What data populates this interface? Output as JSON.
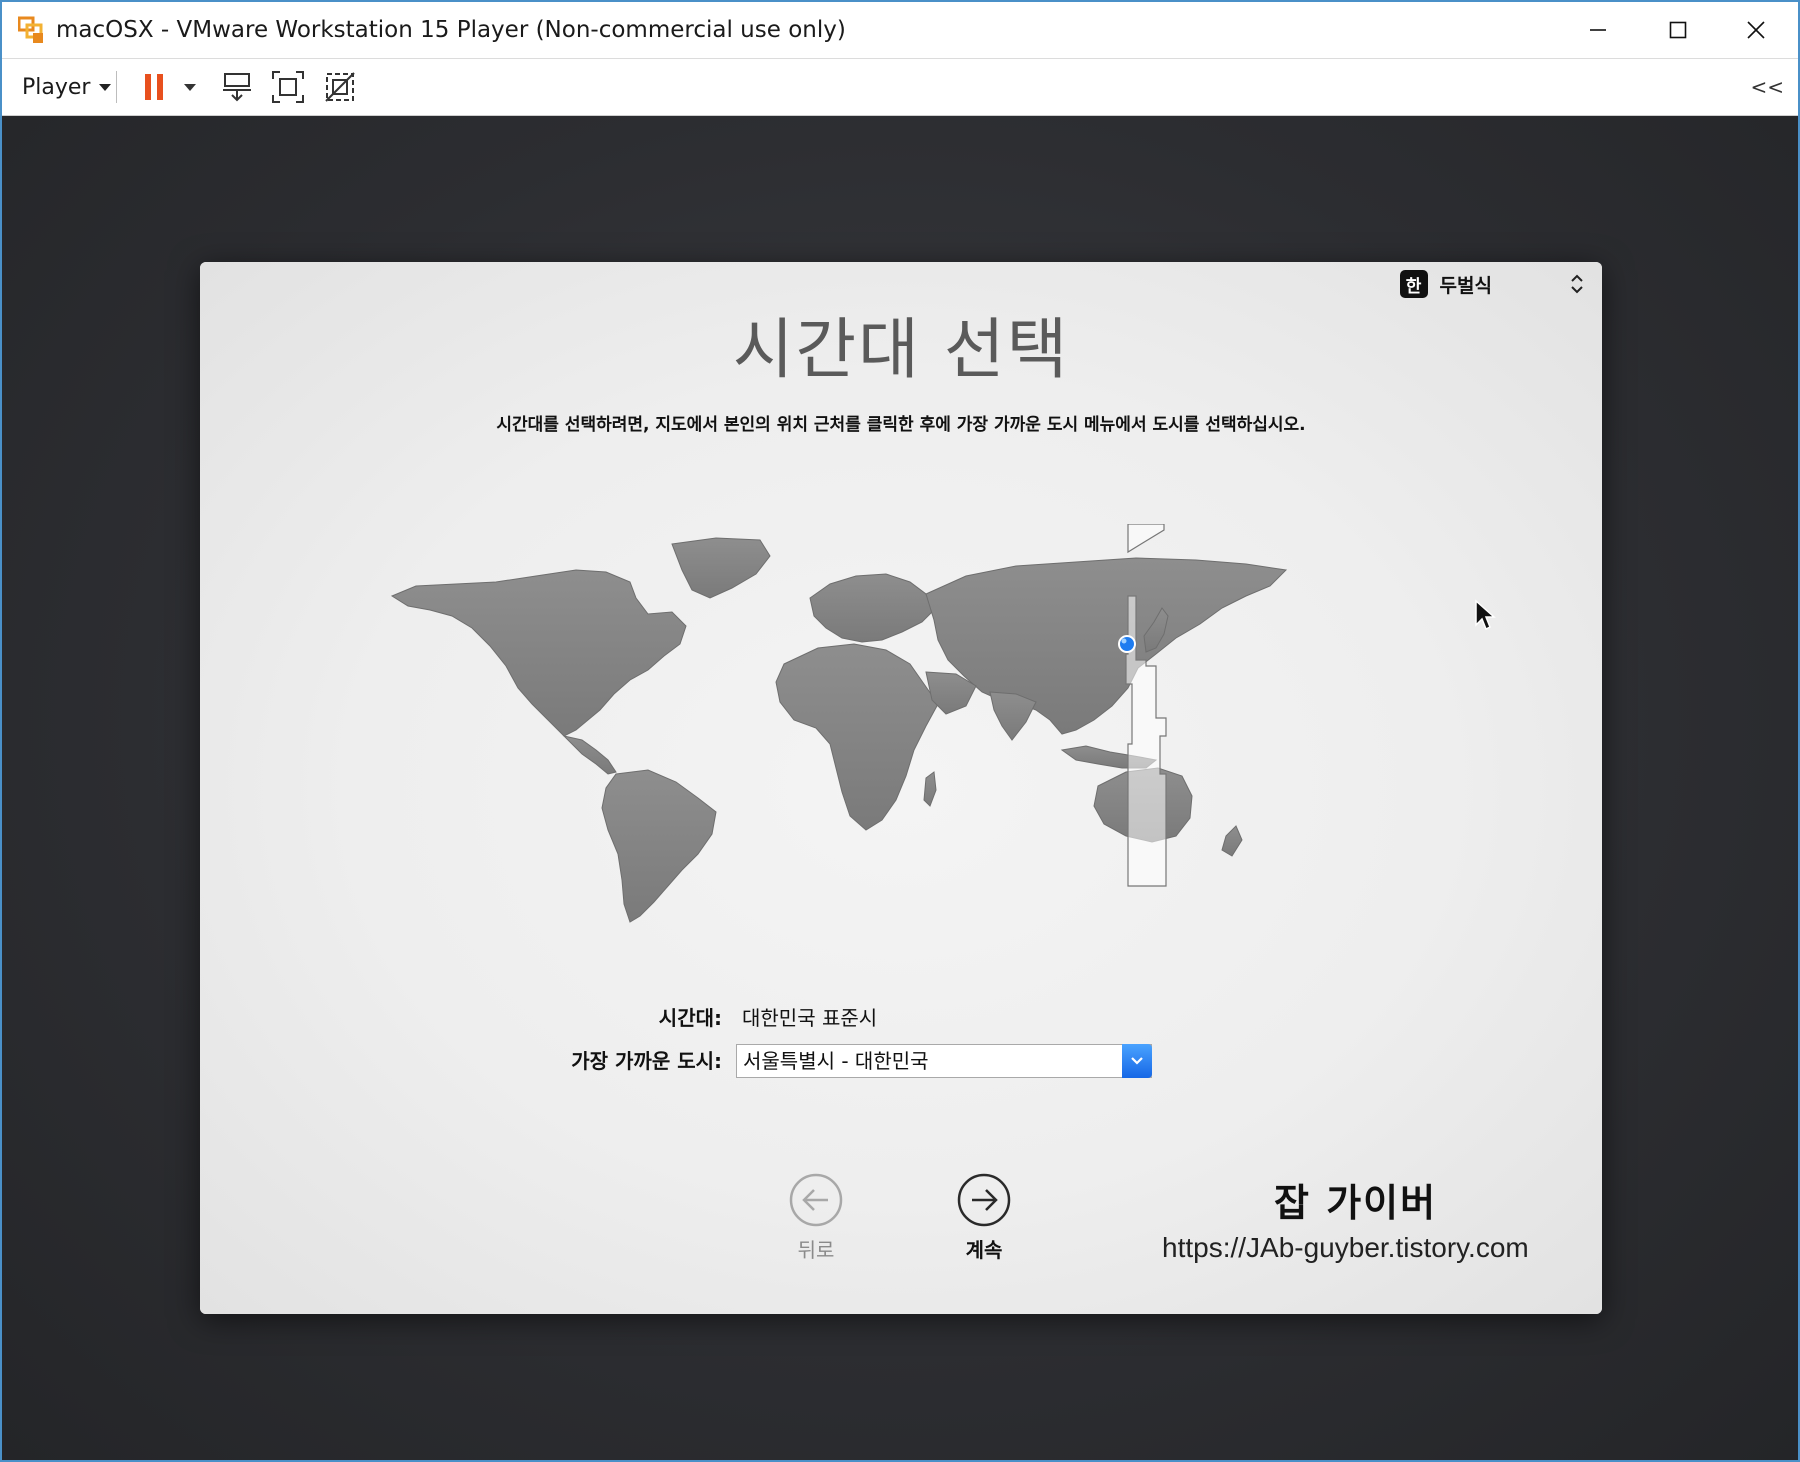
{
  "window": {
    "title": "macOSX - VMware Workstation 15 Player (Non-commercial use only)",
    "controls": [
      "minimize",
      "maximize",
      "close"
    ]
  },
  "toolbar": {
    "player_label": "Player",
    "icons": [
      "pause-icon",
      "dropdown-icon",
      "send-ctrl-alt-del-icon",
      "fullscreen-icon",
      "unity-icon",
      "collapse-icon"
    ],
    "collapse_label": "<<",
    "pause_color": "#e8501e"
  },
  "setup": {
    "input_source": {
      "badge": "한",
      "label": "두벌식"
    },
    "title": "시간대 선택",
    "instructions": "시간대를 선택하려면, 지도에서 본인의 위치 근처를 클릭한 후에 가장 가까운 도시 메뉴에서 도시를 선택하십시오.",
    "timezone_label": "시간대:",
    "timezone_value": "대한민국 표준시",
    "closest_city_label": "가장 가까운 도시:",
    "closest_city_value": "서울특별시 - 대한민국",
    "back_label": "뒤로",
    "continue_label": "계속",
    "accent_color": "#1e7cf0"
  },
  "watermark": {
    "title": "잡 가이버",
    "url": "https://JAb-guyber.tistory.com"
  }
}
